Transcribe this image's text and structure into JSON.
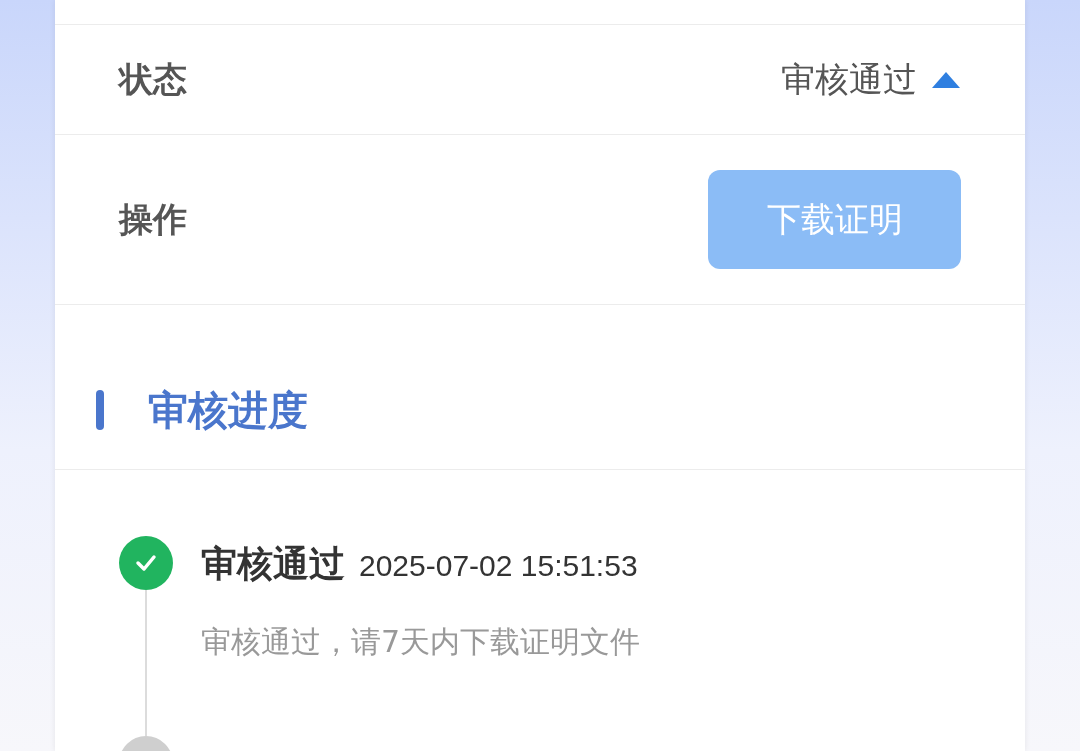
{
  "rows": [
    {
      "kind": "status",
      "label": "状态",
      "value": "审核通过",
      "expanded": true
    },
    {
      "kind": "action",
      "label": "操作",
      "button": {
        "label": "下载证明",
        "disabled": true
      }
    }
  ],
  "section": {
    "title": "审核进度"
  },
  "timeline": [
    {
      "title": "审核通过",
      "time": "2025-07-02 15:51:53",
      "note": "审核通过，请7天内下载证明文件",
      "done": true
    },
    {
      "done": false
    }
  ]
}
